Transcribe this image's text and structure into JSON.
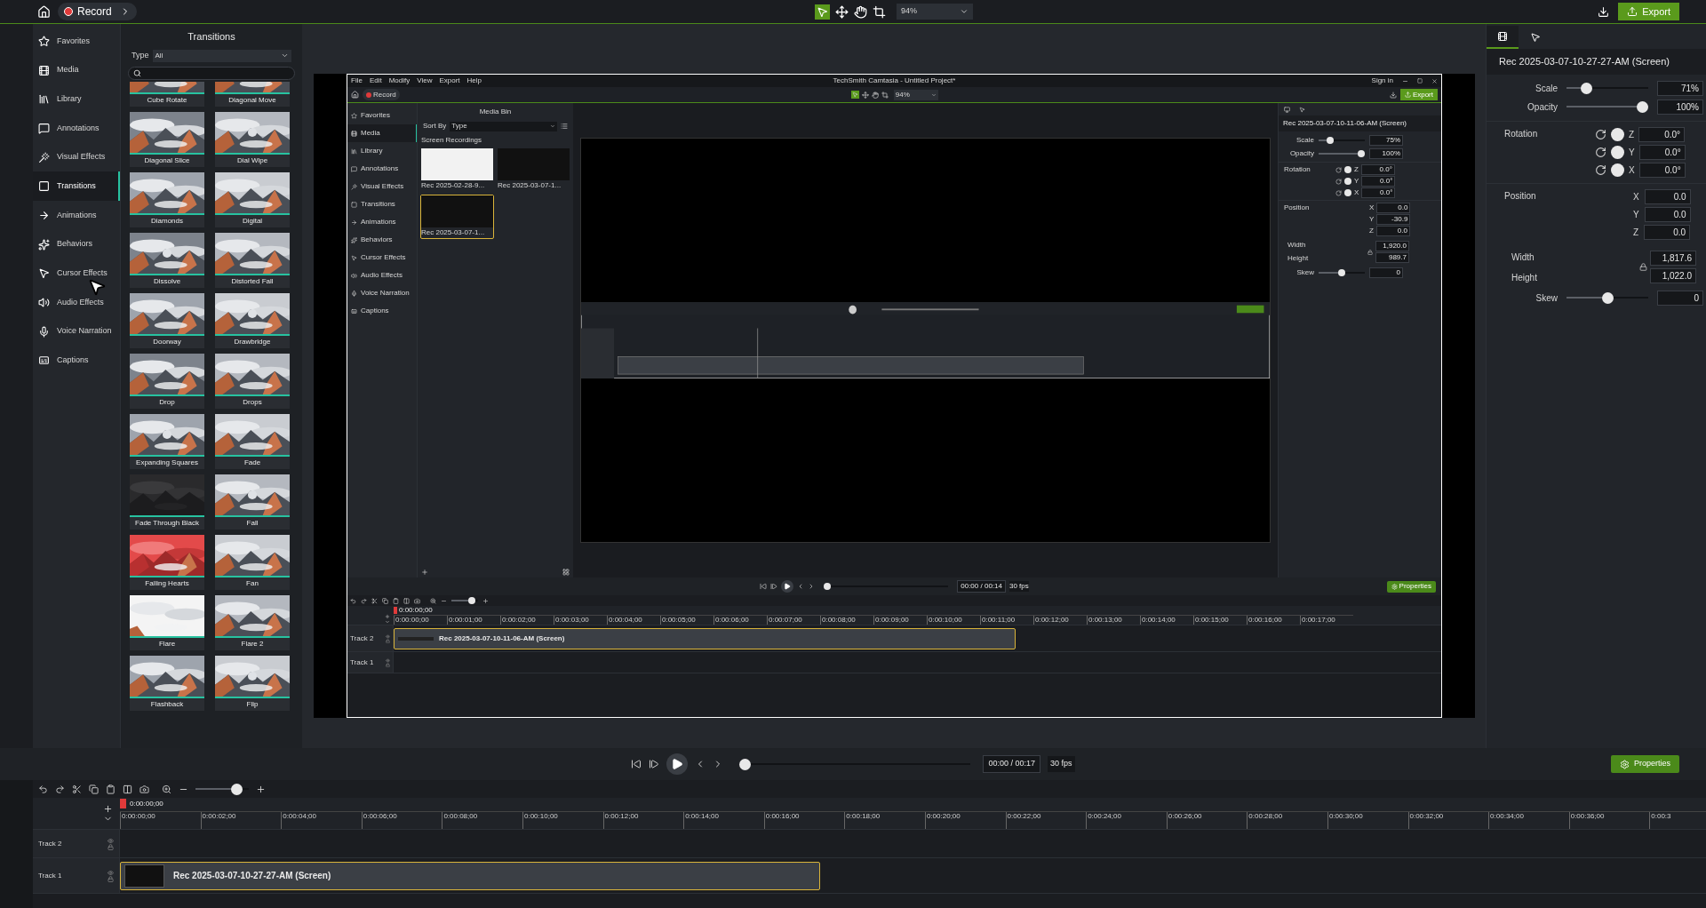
{
  "toolbar": {
    "record": "Record",
    "zoom": "94%",
    "export": "Export"
  },
  "sidebar": {
    "items": [
      {
        "label": "Favorites",
        "selected": false
      },
      {
        "label": "Media",
        "selected": false
      },
      {
        "label": "Library",
        "selected": false
      },
      {
        "label": "Annotations",
        "selected": false
      },
      {
        "label": "Visual Effects",
        "selected": false
      },
      {
        "label": "Transitions",
        "selected": true
      },
      {
        "label": "Animations",
        "selected": false
      },
      {
        "label": "Behaviors",
        "selected": false
      },
      {
        "label": "Cursor Effects",
        "selected": false
      },
      {
        "label": "Audio Effects",
        "selected": false
      },
      {
        "label": "Voice Narration",
        "selected": false
      },
      {
        "label": "Captions",
        "selected": false
      }
    ]
  },
  "transitions": {
    "title": "Transitions",
    "type_label": "Type",
    "type_value": "All",
    "items": [
      {
        "label": "Cube Rotate"
      },
      {
        "label": "Diagonal Move"
      },
      {
        "label": "Diagonal Slice"
      },
      {
        "label": "Dial Wipe"
      },
      {
        "label": "Diamonds"
      },
      {
        "label": "Digital"
      },
      {
        "label": "Dissolve"
      },
      {
        "label": "Distorted Fall"
      },
      {
        "label": "Doorway"
      },
      {
        "label": "Drawbridge"
      },
      {
        "label": "Drop"
      },
      {
        "label": "Drops"
      },
      {
        "label": "Expanding Squares"
      },
      {
        "label": "Fade"
      },
      {
        "label": "Fade Through Black"
      },
      {
        "label": "Fall"
      },
      {
        "label": "Falling Hearts"
      },
      {
        "label": "Fan"
      },
      {
        "label": "Flare"
      },
      {
        "label": "Flare 2"
      },
      {
        "label": "Flashback"
      },
      {
        "label": "Flip"
      }
    ]
  },
  "recording": {
    "menu": [
      "File",
      "Edit",
      "Modify",
      "View",
      "Export",
      "Help"
    ],
    "title": "TechSmith Camtasia - Untitled Project*",
    "sign_in": "Sign in",
    "record": "Record",
    "zoom": "94%",
    "export": "Export",
    "sidebar": [
      {
        "label": "Favorites",
        "selected": false
      },
      {
        "label": "Media",
        "selected": true
      },
      {
        "label": "Library",
        "selected": false
      },
      {
        "label": "Annotations",
        "selected": false
      },
      {
        "label": "Visual Effects",
        "selected": false
      },
      {
        "label": "Transitions",
        "selected": false
      },
      {
        "label": "Animations",
        "selected": false
      },
      {
        "label": "Behaviors",
        "selected": false
      },
      {
        "label": "Cursor Effects",
        "selected": false
      },
      {
        "label": "Audio Effects",
        "selected": false
      },
      {
        "label": "Voice Narration",
        "selected": false
      },
      {
        "label": "Captions",
        "selected": false
      }
    ],
    "media_bin": {
      "title": "Media Bin",
      "sort_label": "Sort By",
      "sort_value": "Type",
      "group": "Screen Recordings",
      "items": [
        {
          "label": "Rec 2025-02-28-9...",
          "selected": false
        },
        {
          "label": "Rec 2025-03-07-1...",
          "selected": false
        },
        {
          "label": "Rec 2025-03-07-1...",
          "selected": true
        }
      ]
    },
    "properties": {
      "clip_title": "Rec 2025-03-07-10-11-06-AM (Screen)",
      "scale": {
        "label": "Scale",
        "level": 0.2,
        "value": "75%"
      },
      "opacity": {
        "label": "Opacity",
        "level": 1,
        "value": "100%"
      },
      "rotation": {
        "label": "Rotation",
        "axes": [
          {
            "axis": "Z",
            "value": "0.0°"
          },
          {
            "axis": "Y",
            "value": "0.0°"
          },
          {
            "axis": "X",
            "value": "0.0°"
          }
        ]
      },
      "position": {
        "label": "Position",
        "axes": [
          {
            "axis": "X",
            "value": "0.0"
          },
          {
            "axis": "Y",
            "value": "-30.9"
          },
          {
            "axis": "Z",
            "value": "0.0"
          }
        ]
      },
      "width": {
        "label": "Width",
        "value": "1,920.0"
      },
      "height": {
        "label": "Height",
        "value": "989.7"
      },
      "skew": {
        "label": "Skew",
        "level": 0.5,
        "value": "0"
      }
    },
    "player": {
      "time": "00:00 / 00:14",
      "fps": "30 fps",
      "properties": "Properties",
      "scrubber": {
        "level": 0
      }
    },
    "timeline": {
      "zoom": {
        "level": 0.85
      },
      "playhead": "0:00:00;00",
      "ticks": [
        "0:00:00;00",
        "0:00:01;00",
        "0:00:02;00",
        "0:00:03;00",
        "0:00:04;00",
        "0:00:05;00",
        "0:00:06;00",
        "0:00:07;00",
        "0:00:08;00",
        "0:00:09;00",
        "0:00:10;00",
        "0:00:11;00",
        "0:00:12;00",
        "0:00:13;00",
        "0:00:14;00",
        "0:00:15;00",
        "0:00:16;00",
        "0:00:17;00"
      ],
      "tracks": [
        {
          "name": "Track 2",
          "clips": [
            {
              "title": "Rec 2025-03-07-10-11-06-AM (Screen)",
              "selected": true
            }
          ]
        },
        {
          "name": "Track 1"
        }
      ]
    }
  },
  "properties": {
    "tabs": [
      {
        "selected": true
      },
      {
        "selected": false
      }
    ],
    "clip_title": "Rec 2025-03-07-10-27-27-AM (Screen)",
    "scale": {
      "label": "Scale",
      "level": 0.2,
      "value": "71%"
    },
    "opacity": {
      "label": "Opacity",
      "level": 1,
      "value": "100%"
    },
    "rotation": {
      "label": "Rotation",
      "axes": [
        {
          "axis": "Z",
          "value": "0.0°"
        },
        {
          "axis": "Y",
          "value": "0.0°"
        },
        {
          "axis": "X",
          "value": "0.0°"
        }
      ]
    },
    "position": {
      "label": "Position",
      "axes": [
        {
          "axis": "X",
          "value": "0.0"
        },
        {
          "axis": "Y",
          "value": "0.0"
        },
        {
          "axis": "Z",
          "value": "0.0"
        }
      ]
    },
    "width": {
      "label": "Width",
      "value": "1,817.6"
    },
    "height": {
      "label": "Height",
      "value": "1,022.0"
    },
    "skew": {
      "label": "Skew",
      "level": 0.5,
      "value": "0"
    }
  },
  "player": {
    "time": "00:00 / 00:17",
    "fps": "30 fps",
    "properties": "Properties",
    "scrubber": {
      "level": 0
    }
  },
  "timeline": {
    "zoom": {
      "level": 0.85
    },
    "playhead": "0:00:00;00",
    "ticks": [
      "0:00:00;00",
      "0:00:02;00",
      "0:00:04;00",
      "0:00:06;00",
      "0:00:08;00",
      "0:00:10;00",
      "0:00:12;00",
      "0:00:14;00",
      "0:00:16;00",
      "0:00:18;00",
      "0:00:20;00",
      "0:00:22;00",
      "0:00:24;00",
      "0:00:26;00",
      "0:00:28;00",
      "0:00:30;00",
      "0:00:32;00",
      "0:00:34;00",
      "0:00:36;00",
      "0:00:3"
    ],
    "tracks": [
      {
        "name": "Track 2"
      },
      {
        "name": "Track 1",
        "clips": [
          {
            "title": "Rec 2025-03-07-10-27-27-AM (Screen)",
            "selected": true
          }
        ]
      }
    ]
  }
}
